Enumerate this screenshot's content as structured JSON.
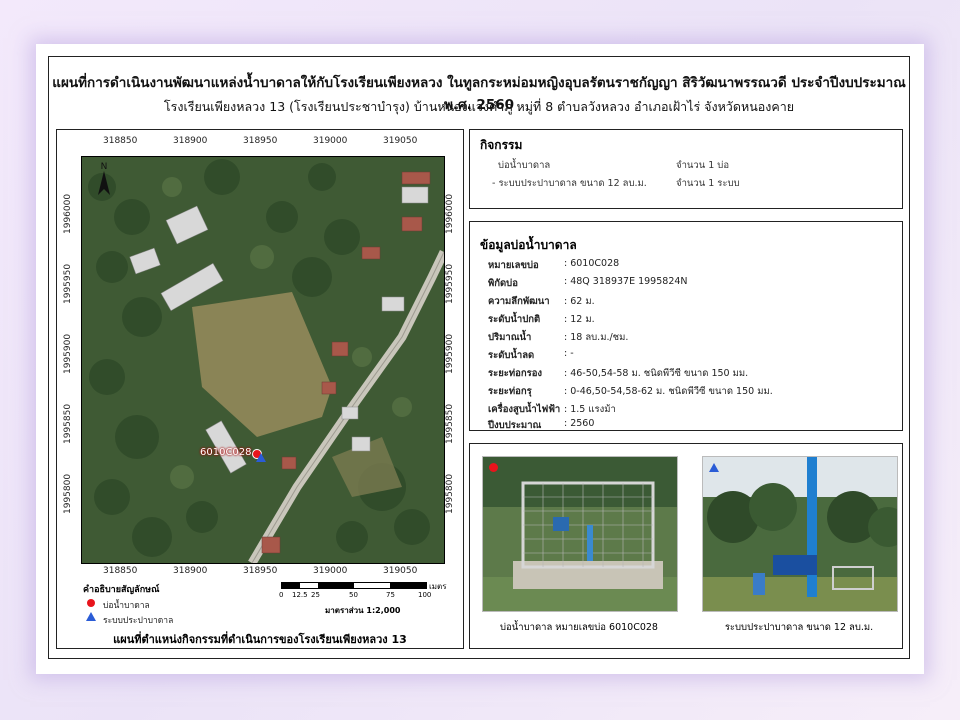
{
  "title": "แผนที่การดำเนินงานพัฒนาแหล่งน้ำบาดาลให้กับโรงเรียนเพียงหลวง ในทูลกระหม่อมหญิงอุบลรัตนราชกัญญา สิริวัฒนาพรรณวดี ประจำปีงบประมาณ พ.ศ. 2560",
  "subtitle": "โรงเรียนเพียงหลวง 13 (โรงเรียนประชาบำรุง) บ้านหนองแวงคำภู หมู่ที่ 8 ตำบลวังหลวง อำเภอเฝ้าไร่ จังหวัดหนองคาย",
  "map": {
    "x_ticks": [
      "318850",
      "318900",
      "318950",
      "319000",
      "319050"
    ],
    "y_ticks": [
      "1996000",
      "1995950",
      "1995900",
      "1995850",
      "1995800"
    ],
    "well_label": "6010C028",
    "scale_labels": [
      "0",
      "12.5",
      "25",
      "50",
      "75",
      "100"
    ],
    "scale_unit": "เมตร",
    "scale_ratio": "มาตราส่วน 1:2,000",
    "legend_title": "คำอธิบายสัญลักษณ์",
    "legend": [
      {
        "label": "บ่อน้ำบาดาล",
        "symbol": "circle",
        "color": "#e8141c"
      },
      {
        "label": "ระบบประปาบาดาล",
        "symbol": "triangle",
        "color": "#2a5cd6"
      }
    ],
    "caption": "แผนที่ตำแหน่งกิจกรรมที่ดำเนินการของโรงเรียนเพียงหลวง 13"
  },
  "activities": {
    "title": "กิจกรรม",
    "items": [
      {
        "name": "บ่อน้ำบาดาล",
        "amount": "จำนวน 1 บ่อ"
      },
      {
        "name": "- ระบบประปาบาดาล ขนาด 12 ลบ.ม.",
        "amount": "จำนวน 1 ระบบ"
      }
    ]
  },
  "well_info": {
    "title": "ข้อมูลบ่อน้ำบาดาล",
    "rows": [
      {
        "label": "หมายเลขบ่อ",
        "value": ": 6010C028"
      },
      {
        "label": "พิกัดบ่อ",
        "value": ": 48Q 318937E 1995824N"
      },
      {
        "label": "ความลึกพัฒนา",
        "value": ": 62 ม."
      },
      {
        "label": "ระดับน้ำปกติ",
        "value": ": 12 ม."
      },
      {
        "label": "ปริมาณน้ำ",
        "value": ": 18 ลบ.ม./ชม."
      },
      {
        "label": "ระดับน้ำลด",
        "value": ": -"
      },
      {
        "label": "ระยะท่อกรอง",
        "value": ": 46-50,54-58 ม. ชนิดพีวีซี  ขนาด 150 มม."
      },
      {
        "label": "ระยะท่อกรุ",
        "value": ": 0-46,50-54,58-62 ม. ชนิดพีวีซี  ขนาด 150 มม."
      },
      {
        "label": "เครื่องสูบน้ำไฟฟ้า",
        "value": ": 1.5 แรงม้า"
      },
      {
        "label": "ปีงบประมาณ",
        "value": ":  2560"
      }
    ]
  },
  "photos": [
    {
      "caption": "บ่อน้ำบาดาล หมายเลขบ่อ 6010C028",
      "marker": "circle",
      "color": "#e8141c"
    },
    {
      "caption": "ระบบประปาบาดาล ขนาด 12 ลบ.ม.",
      "marker": "triangle",
      "color": "#2a5cd6"
    }
  ]
}
